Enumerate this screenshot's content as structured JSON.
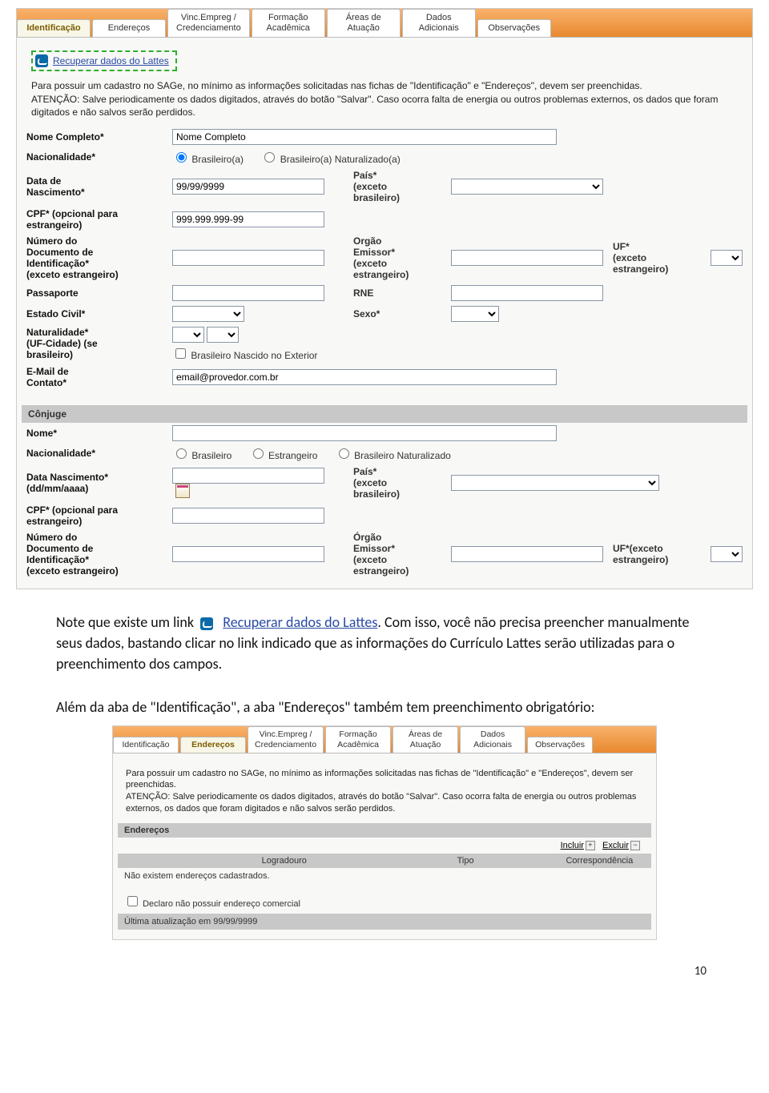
{
  "tabs1": [
    {
      "label": "Identificação"
    },
    {
      "label": "Endereços"
    },
    {
      "label": "Vinc.Empreg /\nCredenciamento"
    },
    {
      "label": "Formação\nAcadêmica"
    },
    {
      "label": "Áreas de\nAtuação"
    },
    {
      "label": "Dados\nAdicionais"
    },
    {
      "label": "Observações"
    }
  ],
  "lattes_link": "Recuperar dados do Lattes",
  "intro1": "Para possuir um cadastro no SAGe, no mínimo as informações solicitadas nas fichas de \"Identificação\" e \"Endereços\", devem ser preenchidas.\nATENÇÃO: Salve periodicamente os dados digitados, através do botão \"Salvar\". Caso ocorra falta de energia ou outros problemas externos, os dados que foram digitados e não salvos serão perdidos.",
  "form": {
    "nome_completo_lbl": "Nome Completo*",
    "nome_completo_val": "Nome Completo",
    "nacionalidade_lbl": "Nacionalidade*",
    "nac_opt1": "Brasileiro(a)",
    "nac_opt2": "Brasileiro(a) Naturalizado(a)",
    "data_nasc_lbl": "Data de\nNascimento*",
    "data_nasc_val": "99/99/9999",
    "pais_lbl": "País*\n(exceto\nbrasileiro)",
    "cpf_lbl": "CPF* (opcional para\nestrangeiro)",
    "cpf_val": "999.999.999-99",
    "doc_lbl": "Número do\nDocumento de\nIdentificação*\n(exceto estrangeiro)",
    "orgao_lbl": "Orgão\nEmissor*\n(exceto\nestrangeiro)",
    "uf_lbl": "UF*\n(exceto\nestrangeiro)",
    "passaporte_lbl": "Passaporte",
    "rne_lbl": "RNE",
    "estado_civil_lbl": "Estado Civil*",
    "sexo_lbl": "Sexo*",
    "naturalidade_lbl": "Naturalidade*\n(UF-Cidade) (se\nbrasileiro)",
    "nascido_ext": "Brasileiro Nascido no Exterior",
    "email_lbl": "E-Mail de\nContato*",
    "email_val": "email@provedor.com.br",
    "conjuge_hdr": "Cônjuge",
    "c_nome_lbl": "Nome*",
    "c_nac_lbl": "Nacionalidade*",
    "c_nac_opt1": "Brasileiro",
    "c_nac_opt2": "Estrangeiro",
    "c_nac_opt3": "Brasileiro Naturalizado",
    "c_data_lbl": "Data Nascimento*\n(dd/mm/aaaa)",
    "c_pais_lbl": "País*\n(exceto\nbrasileiro)",
    "c_cpf_lbl": "CPF* (opcional para\nestrangeiro)",
    "c_doc_lbl": "Número do\nDocumento de\nIdentificação*\n(exceto estrangeiro)",
    "c_orgao_lbl": "Órgão\nEmissor*\n(exceto\nestrangeiro)",
    "c_uf_lbl": "UF*(exceto\nestrangeiro)"
  },
  "para1_a": "Note que existe um link ",
  "para1_link": "Recuperar dados do Lattes",
  "para1_b": ". Com isso, você não precisa preencher manualmente seus dados, bastando clicar no link indicado que as informações do Currículo Lattes serão utilizadas para o preenchimento dos campos.",
  "para2": "Além da aba de \"Identificação\", a aba \"Endereços\" também tem preenchimento obrigatório:",
  "tabs2": [
    {
      "label": "Identificação"
    },
    {
      "label": "Endereços"
    },
    {
      "label": "Vinc.Empreg /\nCredenciamento"
    },
    {
      "label": "Formação\nAcadêmica"
    },
    {
      "label": "Áreas de\nAtuação"
    },
    {
      "label": "Dados\nAdicionais"
    },
    {
      "label": "Observações"
    }
  ],
  "intro2": "Para possuir um cadastro no SAGe, no mínimo as informações solicitadas nas fichas de \"Identificação\" e \"Endereços\", devem ser preenchidas.\nATENÇÃO: Salve periodicamente os dados digitados, através do botão \"Salvar\". Caso ocorra falta de energia ou outros problemas externos, os dados que foram digitados e não salvos serão perdidos.",
  "enderecos_hdr": "Endereços",
  "incluir": "Incluir",
  "excluir": "Excluir",
  "col_logradouro": "Logradouro",
  "col_tipo": "Tipo",
  "col_correspondencia": "Correspondência",
  "empty_addresses": "Não existem endereços cadastrados.",
  "declaro": "Declaro não possuir endereço comercial",
  "ultima_atualizacao": "Última atualização em 99/99/9999",
  "page_number": "10"
}
